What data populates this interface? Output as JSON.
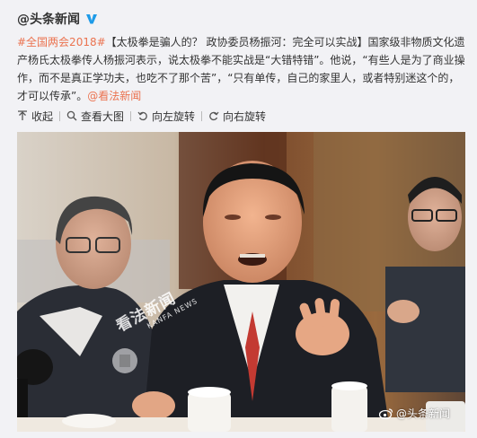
{
  "post": {
    "author": "@头条新闻",
    "text_hashtag": "#全国两会2018#",
    "text_main": "【太极拳是骗人的？ 政协委员杨振河：完全可以实战】国家级非物质文化遗产杨氏太极拳传人杨振河表示，说太极拳不能实战是“大错特错”。他说，“有些人是为了商业操作，而不是真正学功夫，也吃不了那个苦”，“只有单传，自己的家里人，或者特别迷这个的，才可以传承”。",
    "text_source": "@看法新闻"
  },
  "toolbar": {
    "collapse": "收起",
    "view_large": "查看大图",
    "rotate_left": "向左旋转",
    "rotate_right": "向右旋转"
  },
  "photo": {
    "watermark_main": "看法新闻",
    "watermark_sub": "KANFA NEWS",
    "footer_mark": "@头条新闻"
  },
  "colors": {
    "link": "#eb7350",
    "background": "#f2f2f5",
    "verified": "#1e9be8"
  }
}
